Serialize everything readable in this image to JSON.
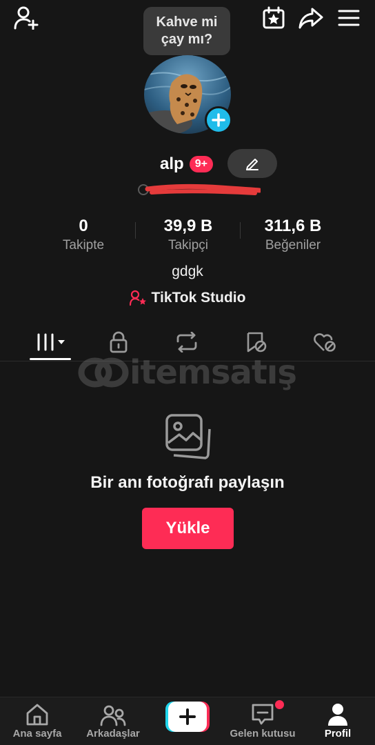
{
  "header": {
    "add_friend_icon": "person-add-icon",
    "calendar_icon": "calendar-star-icon",
    "share_icon": "share-arrow-icon",
    "menu_icon": "hamburger-menu-icon"
  },
  "profile": {
    "note_bubble": "Kahve mi\nçay mı?",
    "username": "alp",
    "notification_badge": "9+",
    "bio": "gdgk",
    "studio_link": "TikTok Studio"
  },
  "stats": [
    {
      "value": "0",
      "label": "Takipte"
    },
    {
      "value": "39,9 B",
      "label": "Takipçi"
    },
    {
      "value": "311,6 B",
      "label": "Beğeniler"
    }
  ],
  "tabs": [
    {
      "name": "videos-grid-icon",
      "active": true
    },
    {
      "name": "lock-icon",
      "active": false
    },
    {
      "name": "repost-icon",
      "active": false
    },
    {
      "name": "favorites-icon",
      "active": false
    },
    {
      "name": "liked-icon",
      "active": false
    }
  ],
  "watermark": "itemsatış",
  "empty_state": {
    "message": "Bir anı fotoğrafı paylaşın",
    "button": "Yükle"
  },
  "bottom_nav": [
    {
      "label": "Ana sayfa",
      "icon": "home-icon",
      "active": false
    },
    {
      "label": "Arkadaşlar",
      "icon": "friends-icon",
      "active": false
    },
    {
      "label": "",
      "icon": "create-plus-icon",
      "active": false
    },
    {
      "label": "Gelen kutusu",
      "icon": "inbox-icon",
      "active": false
    },
    {
      "label": "Profil",
      "icon": "profile-icon",
      "active": true
    }
  ],
  "colors": {
    "background": "#161616",
    "accent": "#fe2c55",
    "cyan": "#20bcea"
  }
}
